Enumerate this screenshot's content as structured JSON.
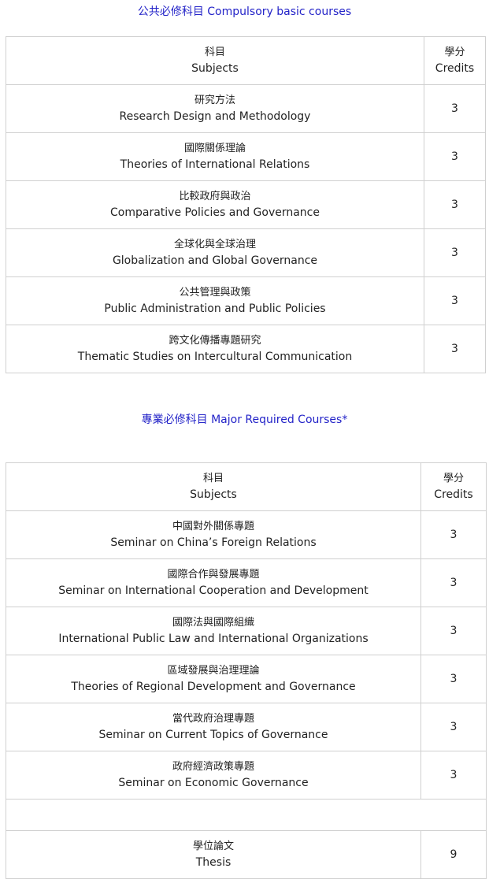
{
  "compulsory": {
    "title": "公共必修科目 Compulsory basic courses",
    "header": {
      "subject_zh": "科目",
      "subject_en": "Subjects",
      "credit_zh": "學分",
      "credit_en": "Credits"
    },
    "rows": [
      {
        "zh": "研究方法",
        "en": "Research Design and Methodology",
        "credits": "3"
      },
      {
        "zh": "國際關係理論",
        "en": "Theories of International Relations",
        "credits": "3"
      },
      {
        "zh": "比較政府與政治",
        "en": "Comparative Policies and Governance",
        "credits": "3"
      },
      {
        "zh": "全球化與全球治理",
        "en": "Globalization and Global Governance",
        "credits": "3"
      },
      {
        "zh": "公共管理與政策",
        "en": "Public Administration and Public Policies",
        "credits": "3"
      },
      {
        "zh": "跨文化傳播專題研究",
        "en": "Thematic Studies on Intercultural Communication",
        "credits": "3"
      }
    ]
  },
  "major": {
    "title": "專業必修科目 Major Required Courses*",
    "header": {
      "subject_zh": "科目",
      "subject_en": "Subjects",
      "credit_zh": "學分",
      "credit_en": "Credits"
    },
    "rows": [
      {
        "zh": "中國對外關係專題",
        "en": "Seminar on China’s Foreign Relations",
        "credits": "3"
      },
      {
        "zh": "國際合作與發展專題",
        "en": "Seminar on International Cooperation and Development",
        "credits": "3"
      },
      {
        "zh": "國際法與國際組織",
        "en": "International Public Law and International Organizations",
        "credits": "3"
      },
      {
        "zh": "區域發展與治理理論",
        "en": "Theories of Regional Development and Governance",
        "credits": "3"
      },
      {
        "zh": "當代政府治理專題",
        "en": "Seminar on Current Topics of Governance",
        "credits": "3"
      },
      {
        "zh": "政府經濟政策專題",
        "en": "Seminar on Economic Governance",
        "credits": "3"
      }
    ],
    "thesis": {
      "zh": "學位論文",
      "en": "Thesis",
      "credits": "9"
    }
  }
}
